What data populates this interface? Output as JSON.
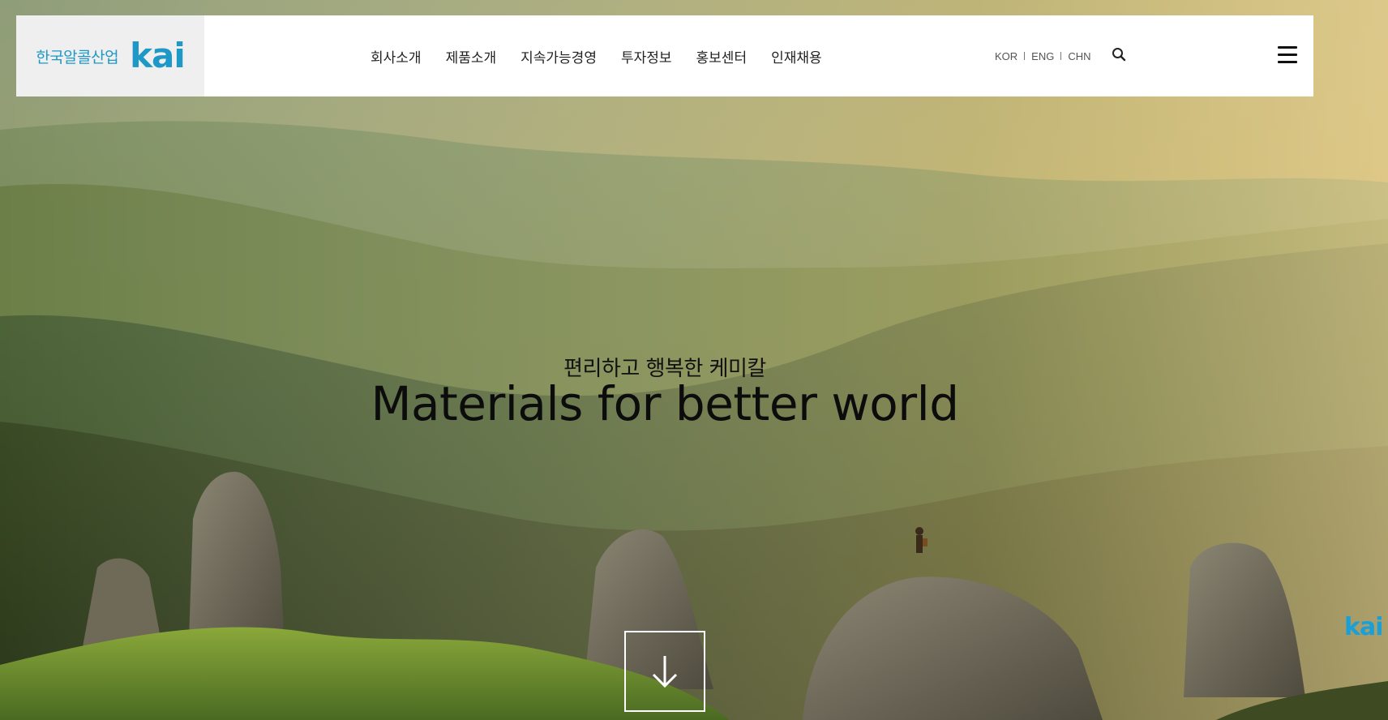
{
  "brand": {
    "name_ko": "한국알콜산업",
    "mark": "kai",
    "color": "#1e98c7"
  },
  "nav": {
    "items": [
      {
        "label": "회사소개"
      },
      {
        "label": "제품소개"
      },
      {
        "label": "지속가능경영"
      },
      {
        "label": "투자정보"
      },
      {
        "label": "홍보센터"
      },
      {
        "label": "인재채용"
      }
    ]
  },
  "languages": [
    "KOR",
    "ENG",
    "CHN"
  ],
  "icons": {
    "search": "search-icon",
    "menu": "hamburger-menu-icon",
    "scroll": "arrow-down-icon"
  },
  "hero": {
    "subtitle": "편리하고 행복한 케미칼",
    "title": "Materials for better world"
  },
  "side_badge": "kai"
}
